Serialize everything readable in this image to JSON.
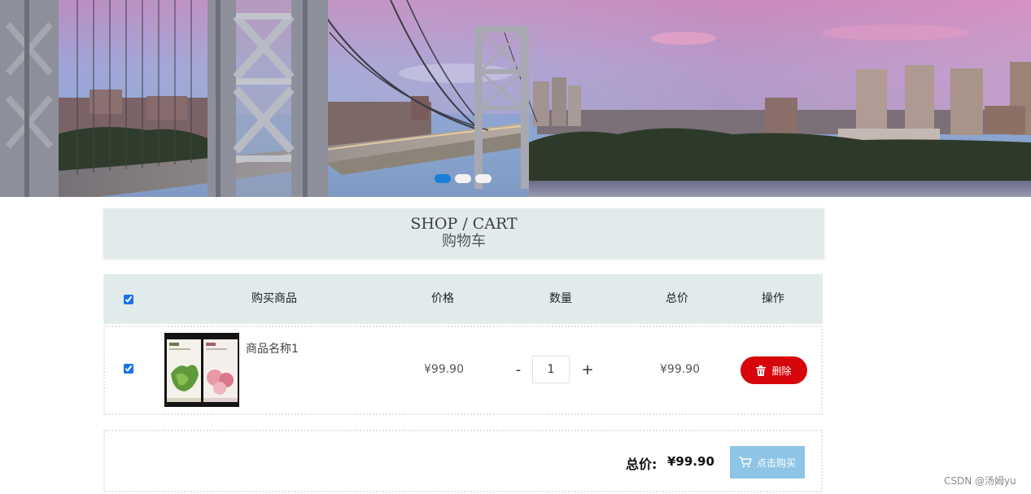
{
  "header": {
    "title_en": "SHOP / CART",
    "title_cn": "购物车"
  },
  "table": {
    "columns": [
      "购买商品",
      "价格",
      "数量",
      "总价",
      "操作"
    ],
    "select_all_checked": true
  },
  "items": [
    {
      "name": "商品名称1",
      "price": "¥99.90",
      "quantity": "1",
      "total": "¥99.90",
      "checked": true,
      "delete_label": "删除",
      "minus_label": "-",
      "plus_label": "+"
    }
  ],
  "footer": {
    "total_label": "总价:",
    "total_value": "¥99.90",
    "buy_label": "点击购买"
  },
  "carousel": {
    "slide_count": 3,
    "active_index": 0
  },
  "watermark": "CSDN @汤姆yu",
  "colors": {
    "header_bg": "#e2ebeb",
    "delete_button": "#d6060b",
    "buy_button": "#8ec5e6",
    "carousel_active": "#1a7fd8",
    "carousel_inactive": "#f2f2f2"
  },
  "icons": {
    "delete": "trash-icon",
    "buy": "cart-icon"
  }
}
